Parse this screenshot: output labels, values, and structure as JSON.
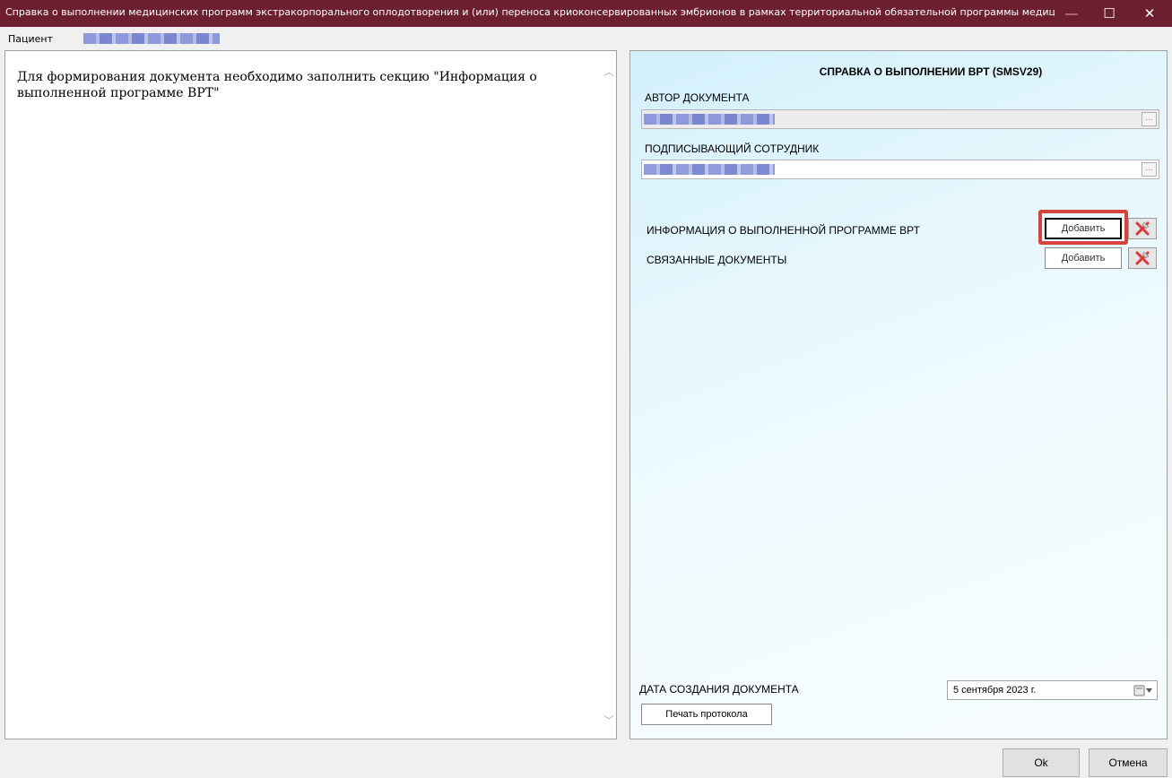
{
  "window": {
    "title": "Справка о выполнении медицинских программ экстракорпорального оплодотворения и (или) переноса криоконсервированных эмбрионов в рамках территориальной обязательной программы медицинск...",
    "minimize_glyph": "—",
    "maximize_glyph": "☐",
    "close_glyph": "✕"
  },
  "patient": {
    "label": "Пациент"
  },
  "left": {
    "message": "Для формирования документа необходимо заполнить секцию \"Информация о выполненной программе ВРТ\"",
    "scroll_up": "︿",
    "scroll_down": "﹀"
  },
  "document": {
    "title": "СПРАВКА О ВЫПОЛНЕНИИ ВРТ (SMSV29)",
    "author_label": "АВТОР ДОКУМЕНТА",
    "signer_label": "ПОДПИСЫВАЮЩИЙ СОТРУДНИК",
    "ellipsis": "...",
    "sections": [
      {
        "label": "ИНФОРМАЦИЯ О ВЫПОЛНЕННОЙ ПРОГРАММЕ ВРТ",
        "add_label": "Добавить"
      },
      {
        "label": "СВЯЗАННЫЕ ДОКУМЕНТЫ",
        "add_label": "Добавить"
      }
    ],
    "date_label": "ДАТА СОЗДАНИЯ ДОКУМЕНТА",
    "date_value": "5 сентября 2023 г.",
    "print_label": "Печать протокола"
  },
  "footer": {
    "ok_label": "Ok",
    "cancel_label": "Отмена"
  },
  "colors": {
    "titlebar": "#6b1f2f",
    "highlight": "#d6453d",
    "delete_icon": "#d93a3a"
  },
  "icons": [
    "delete-icon",
    "calendar-icon",
    "dropdown-arrow-icon"
  ]
}
